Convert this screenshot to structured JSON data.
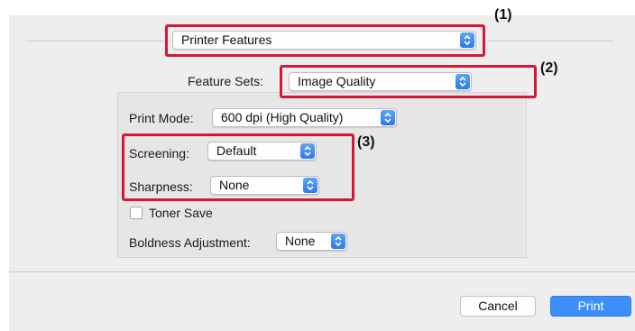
{
  "header": {
    "feature_popup": "Printer Features"
  },
  "feature_sets": {
    "label": "Feature Sets:",
    "value": "Image Quality"
  },
  "options": {
    "print_mode": {
      "label": "Print Mode:",
      "value": "600 dpi (High Quality)"
    },
    "screening": {
      "label": "Screening:",
      "value": "Default"
    },
    "sharpness": {
      "label": "Sharpness:",
      "value": "None"
    },
    "toner_save": {
      "label": "Toner Save",
      "checked": false
    },
    "boldness": {
      "label": "Boldness Adjustment:",
      "value": "None"
    }
  },
  "buttons": {
    "cancel": "Cancel",
    "print": "Print"
  },
  "callouts": {
    "c1": "(1)",
    "c2": "(2)",
    "c3": "(3)"
  },
  "colors": {
    "highlight": "#d41737",
    "accent": "#3d8ef6"
  }
}
